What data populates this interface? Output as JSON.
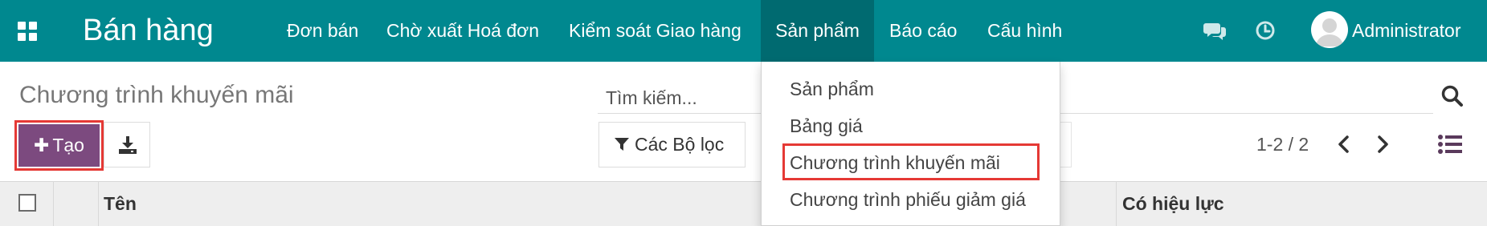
{
  "navbar": {
    "app_title": "Bán hàng",
    "menu": [
      {
        "label": "Đơn bán"
      },
      {
        "label": "Chờ xuất Hoá đơn"
      },
      {
        "label": "Kiểm soát Giao hàng"
      },
      {
        "label": "Sản phẩm",
        "active": true
      },
      {
        "label": "Báo cáo"
      },
      {
        "label": "Cấu hình"
      }
    ],
    "user_name": "Administrator"
  },
  "dropdown": {
    "items": [
      {
        "label": "Sản phẩm"
      },
      {
        "label": "Bảng giá"
      },
      {
        "label": "Chương trình khuyến mãi",
        "highlighted": true
      },
      {
        "label": "Chương trình phiếu giảm giá"
      }
    ]
  },
  "control_panel": {
    "title": "Chương trình khuyến mãi",
    "search_placeholder": "Tìm kiếm...",
    "create_label": "Tạo",
    "filters_label": "Các Bộ lọc",
    "pager": "1-2 / 2"
  },
  "list": {
    "columns": [
      "Tên",
      "Có hiệu lực"
    ]
  },
  "colors": {
    "navbar": "#00888f",
    "navbar_active": "#006a70",
    "primary_button": "#7c4a7f",
    "highlight_border": "#e53935"
  },
  "icons": {
    "apps": "apps-grid-icon",
    "chat": "chat-icon",
    "activity": "clock-icon",
    "search": "search-icon",
    "import": "download-icon",
    "filter": "filter-icon",
    "pager_prev": "chevron-left-icon",
    "pager_next": "chevron-right-icon",
    "list_view": "list-view-icon"
  }
}
